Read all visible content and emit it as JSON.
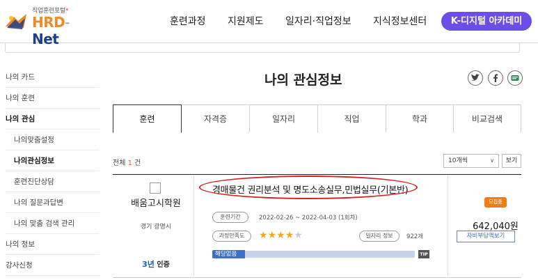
{
  "header": {
    "logo": {
      "subtitle": "직업훈련포털",
      "star": "*",
      "brand_hrd": "HRD",
      "brand_dash": "-",
      "brand_net": "Net"
    },
    "nav": [
      "훈련과정",
      "지원제도",
      "일자리·직업정보",
      "지식정보센터"
    ],
    "cta": "K-디지털 아카데미"
  },
  "sidebar": {
    "items": [
      {
        "label": "나의 카드"
      },
      {
        "label": "나의 훈련"
      },
      {
        "label": "나의 관심"
      },
      {
        "label": "나의맞춤설정"
      },
      {
        "label": "나의관심정보"
      },
      {
        "label": "훈련진단상담"
      },
      {
        "label": "나의 질문과답변"
      },
      {
        "label": "나의 맞춤 검색 관리"
      },
      {
        "label": "나의 정보"
      },
      {
        "label": "강사신청"
      }
    ]
  },
  "main": {
    "title": "나의 관심정보",
    "share_icons": [
      "twitter-icon",
      "facebook-icon",
      "message-icon"
    ],
    "tabs": [
      {
        "label": "훈련"
      },
      {
        "label": "자격증"
      },
      {
        "label": "일자리"
      },
      {
        "label": "직업"
      },
      {
        "label": "학과"
      },
      {
        "label": "비교검색"
      }
    ],
    "total": {
      "prefix": "전체",
      "count": "1",
      "suffix": "건"
    },
    "per_page": "10개씩",
    "view_button": "보기",
    "course": {
      "org_name": "배움고시학원",
      "org_location": "경기 광명시",
      "cert_year": "3년",
      "cert_label": "인증",
      "title": "경매물건 권리분석 및 명도소송실무,민법실무(기본반)",
      "period_label": "훈련기간",
      "period": "2022-02-26 ~ 2022-04-03 (1회차)",
      "satisfaction_label": "과정만족도",
      "rating": 4,
      "rating_max": 5,
      "jobinfo_label": "일자리 정보",
      "jobinfo_count": "922개",
      "bar_label": "해당없음",
      "bar_fill_fraction": 0.16,
      "tip": "TIP",
      "status": "모집중",
      "price": "642,040원",
      "self_pay_button": "자비부담액보기"
    }
  },
  "colors": {
    "accent_purple": "#6c4de6",
    "brand_orange": "#f08a24",
    "brand_navy": "#1c3f8c",
    "star_on": "#f0a81c",
    "bar_blue": "#3d6fc2",
    "status_orange": "#f07d1a",
    "highlight_red": "#d81f1f"
  }
}
